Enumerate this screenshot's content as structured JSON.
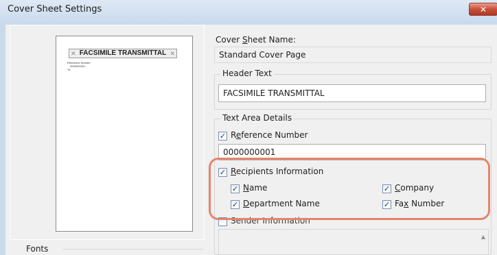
{
  "window": {
    "title": "Cover Sheet Settings",
    "close_glyph": "✕"
  },
  "preview": {
    "header": "FACSIMILE TRANSMITTAL",
    "lines": [
      "Reference Number",
      "0000000001",
      "To:"
    ]
  },
  "cover_sheet_name": {
    "label_pre": "Cover ",
    "label_key": "S",
    "label_post": "heet Name:",
    "value": "Standard Cover Page"
  },
  "header_text": {
    "label": "Header Text",
    "value": "FACSIMILE TRANSMITTAL"
  },
  "text_area_details": {
    "label": "Text Area Details",
    "reference_number": {
      "pre": "R",
      "key": "e",
      "post": "ference Number",
      "checked": true,
      "value": "0000000001"
    },
    "recipients_information": {
      "pre": "",
      "key": "R",
      "post": "ecipients Information",
      "checked": true
    },
    "name": {
      "pre": "",
      "key": "N",
      "post": "ame",
      "checked": true
    },
    "company": {
      "pre": "",
      "key": "C",
      "post": "ompany",
      "checked": true
    },
    "department_name": {
      "pre": "",
      "key": "D",
      "post": "epartment Name",
      "checked": true
    },
    "fax_number": {
      "pre": "Fa",
      "key": "x",
      "post": " Number",
      "checked": true
    },
    "sender_information": {
      "label": "Sender Information",
      "checked": false
    }
  },
  "fonts": {
    "label": "Fonts"
  },
  "check_glyph": "✓",
  "colors": {
    "highlight": "#e5846a",
    "close": "#c7503a",
    "titlebar": "#c8d9ec"
  }
}
